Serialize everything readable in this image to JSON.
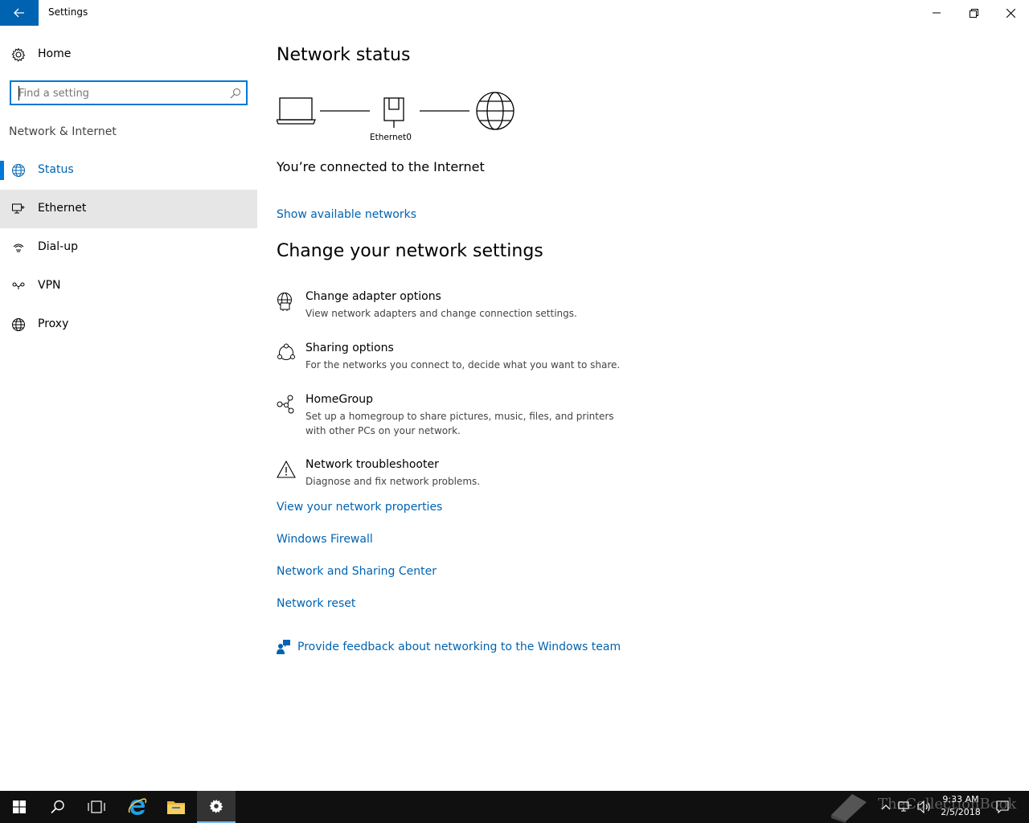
{
  "window": {
    "title": "Settings",
    "controls": [
      "minimize",
      "restore",
      "close"
    ]
  },
  "sidebar": {
    "home_label": "Home",
    "search": {
      "placeholder": "Find a setting",
      "value": ""
    },
    "section_title": "Network & Internet",
    "items": [
      {
        "label": "Status",
        "icon": "globe-status-icon",
        "active": true
      },
      {
        "label": "Ethernet",
        "icon": "ethernet-icon",
        "hover": true
      },
      {
        "label": "Dial-up",
        "icon": "dialup-icon"
      },
      {
        "label": "VPN",
        "icon": "vpn-icon"
      },
      {
        "label": "Proxy",
        "icon": "globe-icon"
      }
    ]
  },
  "main": {
    "network_status_title": "Network status",
    "adapter_label": "Ethernet0",
    "connected_text": "You’re connected to the Internet",
    "show_networks_link": "Show available networks",
    "change_title": "Change your network settings",
    "options": [
      {
        "title": "Change adapter options",
        "desc": "View network adapters and change connection settings.",
        "icon": "adapter-icon"
      },
      {
        "title": "Sharing options",
        "desc": "For the networks you connect to, decide what you want to share.",
        "icon": "sharing-icon"
      },
      {
        "title": "HomeGroup",
        "desc": "Set up a homegroup to share pictures, music, files, and printers with other PCs on your network.",
        "icon": "homegroup-icon"
      },
      {
        "title": "Network troubleshooter",
        "desc": "Diagnose and fix network problems.",
        "icon": "warning-icon"
      }
    ],
    "links": [
      "View your network properties",
      "Windows Firewall",
      "Network and Sharing Center",
      "Network reset"
    ],
    "feedback_link": "Provide feedback about networking to the Windows team"
  },
  "taskbar": {
    "clock_time": "9:33 AM",
    "clock_date": "2/5/2018",
    "watermark": "TheCollectionBook",
    "accent": "#0078d7"
  }
}
